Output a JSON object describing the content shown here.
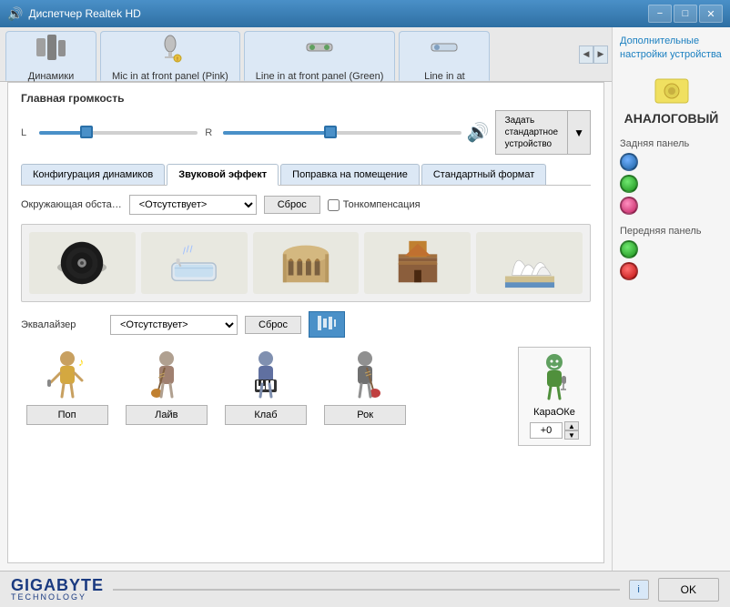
{
  "titlebar": {
    "title": "Диспетчер Realtek HD",
    "icon": "🔊",
    "btn_minimize": "−",
    "btn_maximize": "□",
    "btn_close": "✕"
  },
  "tabs": [
    {
      "id": "dynamics",
      "icon": "🔊",
      "label": "Динамики",
      "active": false
    },
    {
      "id": "mic_front",
      "icon": "🎤",
      "label": "Mic in at front panel (Pink)",
      "active": false
    },
    {
      "id": "line_front",
      "icon": "🔌",
      "label": "Line in at front panel (Green)",
      "active": false
    },
    {
      "id": "line_in",
      "icon": "🔌",
      "label": "Line in at",
      "active": false
    }
  ],
  "volume": {
    "title": "Главная громкость",
    "label_l": "L",
    "label_r": "R",
    "level": 30,
    "default_device_label": "Задать\nстандартное\nустройство",
    "default_device_arrow": "▼"
  },
  "inner_tabs": [
    {
      "id": "config",
      "label": "Конфигурация динамиков",
      "active": false
    },
    {
      "id": "sound_fx",
      "label": "Звуковой эффект",
      "active": true
    },
    {
      "id": "room",
      "label": "Поправка на помещение",
      "active": false
    },
    {
      "id": "format",
      "label": "Стандартный формат",
      "active": false
    }
  ],
  "effects": {
    "env_label": "Окружающая обста…",
    "env_value": "<Отсутствует>",
    "env_placeholder": "<Отсутствует>",
    "reset_label": "Сброс",
    "toncomp_label": "Тонкомпенсация",
    "eq_label": "Эквалайзер",
    "eq_value": "<Отсутствует>",
    "eq_placeholder": "<Отсутствует>",
    "eq_reset_label": "Сброс"
  },
  "scenes": [
    {
      "id": "vinyl",
      "label": "Vinyl"
    },
    {
      "id": "bath",
      "label": "Bath"
    },
    {
      "id": "colosseum",
      "label": "Colosseum"
    },
    {
      "id": "logs",
      "label": "Logs"
    },
    {
      "id": "opera",
      "label": "Opera"
    }
  ],
  "characters": [
    {
      "id": "pop",
      "label": "Поп",
      "color": "#c8a060"
    },
    {
      "id": "live",
      "label": "Лайв",
      "color": "#a0a0a0"
    },
    {
      "id": "club",
      "label": "Клаб",
      "color": "#6080b0"
    },
    {
      "id": "rock",
      "label": "Рок",
      "color": "#707070"
    }
  ],
  "karaoke": {
    "label": "КараОКе",
    "value": "+0"
  },
  "right_panel": {
    "settings_link": "Дополнительные настройки устройства",
    "analog_title": "АНАЛОГОВЫЙ",
    "back_panel": "Задняя панель",
    "front_panel": "Передняя панель",
    "jacks_back": [
      "blue",
      "green",
      "pink"
    ],
    "jacks_front": [
      "green2",
      "red"
    ]
  },
  "footer": {
    "logo_top": "GIGABYTE",
    "logo_bottom": "TECHNOLOGY",
    "info_icon": "i",
    "ok_label": "OK"
  }
}
